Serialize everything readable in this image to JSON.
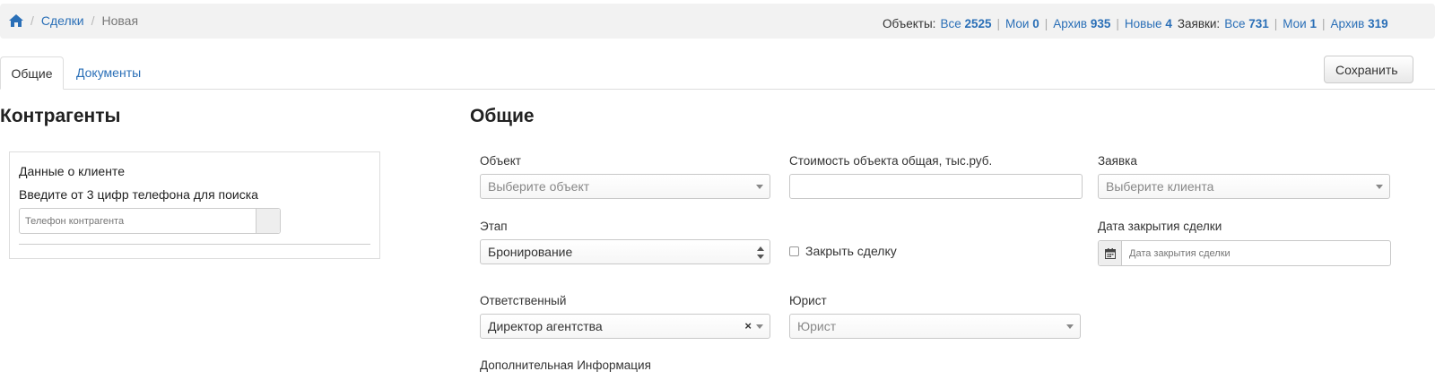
{
  "breadcrumb": {
    "home_icon": "home-icon",
    "items": [
      "Сделки",
      "Новая"
    ]
  },
  "stats": {
    "objects_label": "Объекты:",
    "objects": [
      {
        "label": "Все",
        "count": "2525"
      },
      {
        "label": "Мои",
        "count": "0"
      },
      {
        "label": "Архив",
        "count": "935"
      },
      {
        "label": "Новые",
        "count": "4"
      }
    ],
    "requests_label": "Заявки:",
    "requests": [
      {
        "label": "Все",
        "count": "731"
      },
      {
        "label": "Мои",
        "count": "1"
      },
      {
        "label": "Архив",
        "count": "319"
      }
    ]
  },
  "tabs": [
    {
      "label": "Общие",
      "active": true
    },
    {
      "label": "Документы",
      "active": false
    }
  ],
  "toolbar": {
    "save_label": "Сохранить"
  },
  "contractors": {
    "title": "Контрагенты",
    "client_data_label": "Данные о клиенте",
    "search_hint": "Введите от 3 цифр телефона для поиска",
    "phone_placeholder": "Телефон контрагента"
  },
  "general": {
    "title": "Общие",
    "object": {
      "label": "Объект",
      "placeholder": "Выберите объект"
    },
    "cost": {
      "label": "Стоимость объекта общая, тыс.руб.",
      "value": ""
    },
    "request": {
      "label": "Заявка",
      "placeholder": "Выберите клиента"
    },
    "stage": {
      "label": "Этап",
      "value": "Бронирование"
    },
    "close_deal": {
      "label": "Закрыть сделку",
      "checked": false
    },
    "close_date": {
      "label": "Дата закрытия сделки",
      "placeholder": "Дата закрытия сделки",
      "icon": "calendar-icon"
    },
    "responsible": {
      "label": "Ответственный",
      "value": "Директор агентства",
      "clear": "×"
    },
    "lawyer": {
      "label": "Юрист",
      "placeholder": "Юрист"
    },
    "additional_info": {
      "label": "Дополнительная Информация"
    }
  },
  "colors": {
    "link": "#2a6fb7",
    "bar_bg": "#f2f2f2"
  }
}
